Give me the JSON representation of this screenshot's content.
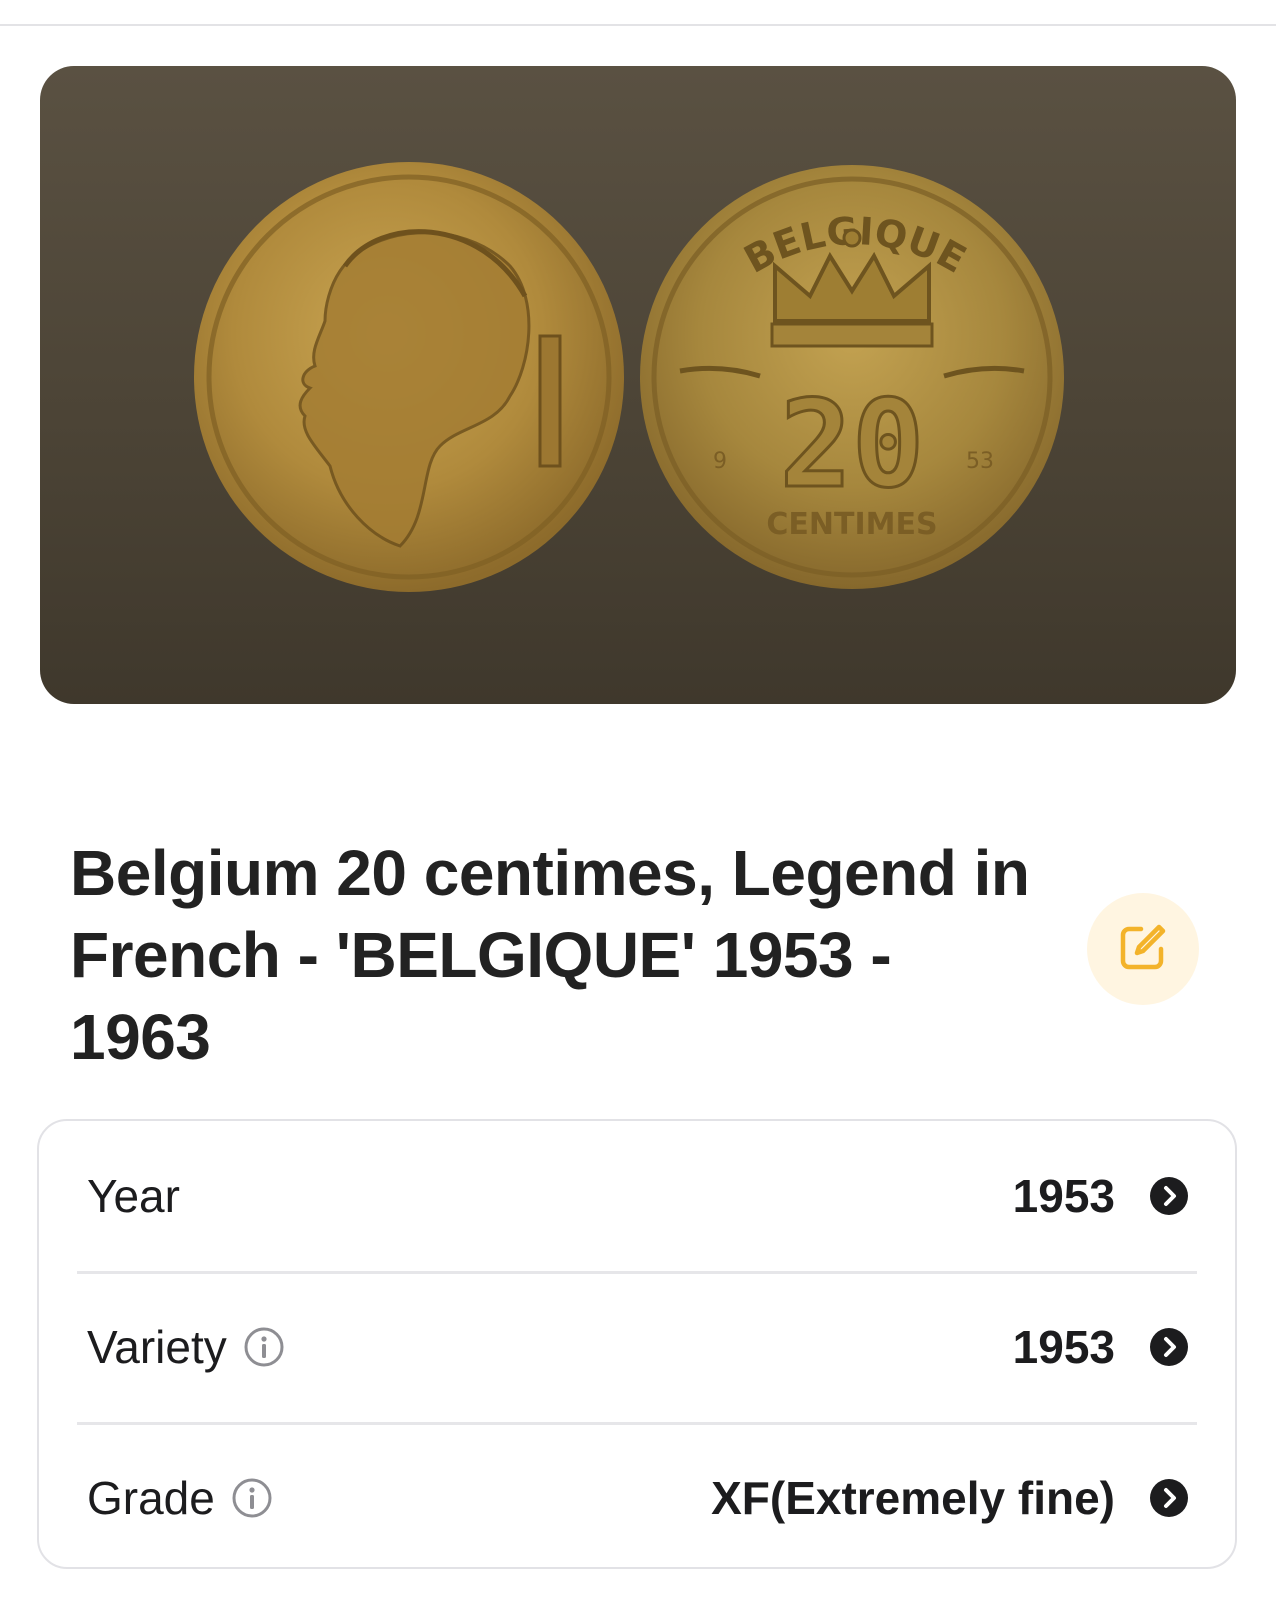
{
  "item": {
    "title": "Belgium 20 centimes, Legend in French - 'BELGIQUE' 1953 - 1963"
  },
  "coin_photo": {
    "reverse_legend": "BELGIQUE",
    "denomination": "20",
    "unit": "CENTIMES",
    "date_left": "9",
    "date_right": "53"
  },
  "icons": {
    "edit": "edit-icon",
    "info": "info-icon",
    "chevron": "chevron-right-icon"
  },
  "colors": {
    "accent": "#f3b32a",
    "accent_bg": "#fff5e1"
  },
  "details": [
    {
      "label": "Year",
      "value": "1953",
      "has_info": false
    },
    {
      "label": "Variety",
      "value": "1953",
      "has_info": true
    },
    {
      "label": "Grade",
      "value": "XF(Extremely fine)",
      "has_info": true
    }
  ]
}
